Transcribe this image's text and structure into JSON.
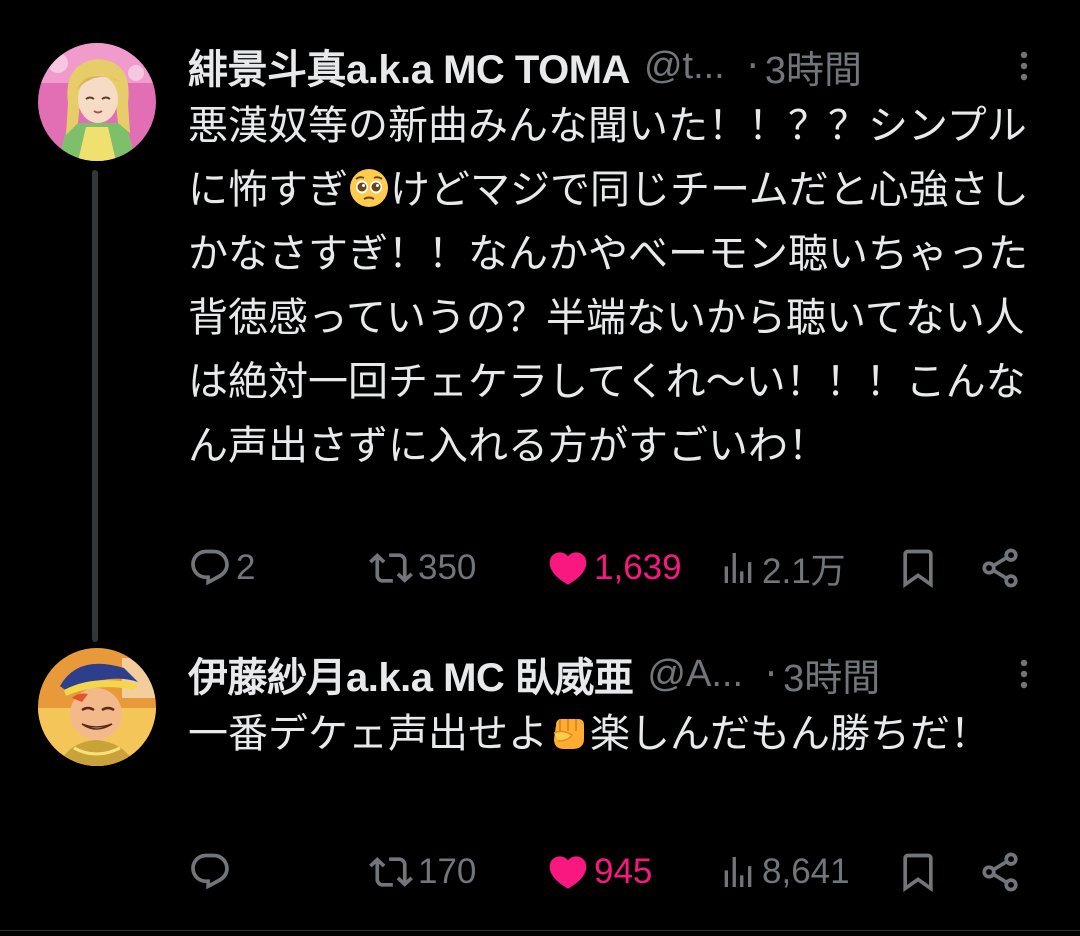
{
  "colors": {
    "background": "#000000",
    "text": "#e7e9ea",
    "secondary": "#71767b",
    "like": "#f91880",
    "thread_line": "#333639"
  },
  "tweets": [
    {
      "display_name": "緋景斗真a.k.a MC TOMA",
      "handle": "@t...",
      "dot": "·",
      "time": "3時間",
      "text_before_emoji": "悪漢奴等の新曲みんな聞いた！！？？シンプルに怖すぎ",
      "emoji": "pleading-face-emoji",
      "text_after_emoji": "けどマジで同じチームだと心強さしかなさすぎ！！なんかやべーモン聴いちゃった背徳感っていうの？半端ないから聴いてない人は絶対一回チェケラしてくれ〜い！！！こんなん声出さずに入れる方がすごいわ！",
      "replies": "2",
      "retweets": "350",
      "likes": "1,639",
      "liked": true,
      "views": "2.1万",
      "icons": [
        "reply-icon",
        "retweet-icon",
        "heart-icon",
        "views-icon",
        "bookmark-icon",
        "share-icon",
        "more-icon"
      ]
    },
    {
      "display_name": "伊藤紗月a.k.a MC 臥威亜",
      "handle": "@A...",
      "dot": "·",
      "time": "3時間",
      "text_before_emoji": "一番デケェ声出せよ",
      "emoji": "fist-emoji",
      "text_after_emoji": "楽しんだもん勝ちだ！",
      "replies": "",
      "retweets": "170",
      "likes": "945",
      "liked": true,
      "views": "8,641",
      "icons": [
        "reply-icon",
        "retweet-icon",
        "heart-icon",
        "views-icon",
        "bookmark-icon",
        "share-icon",
        "more-icon"
      ]
    }
  ]
}
